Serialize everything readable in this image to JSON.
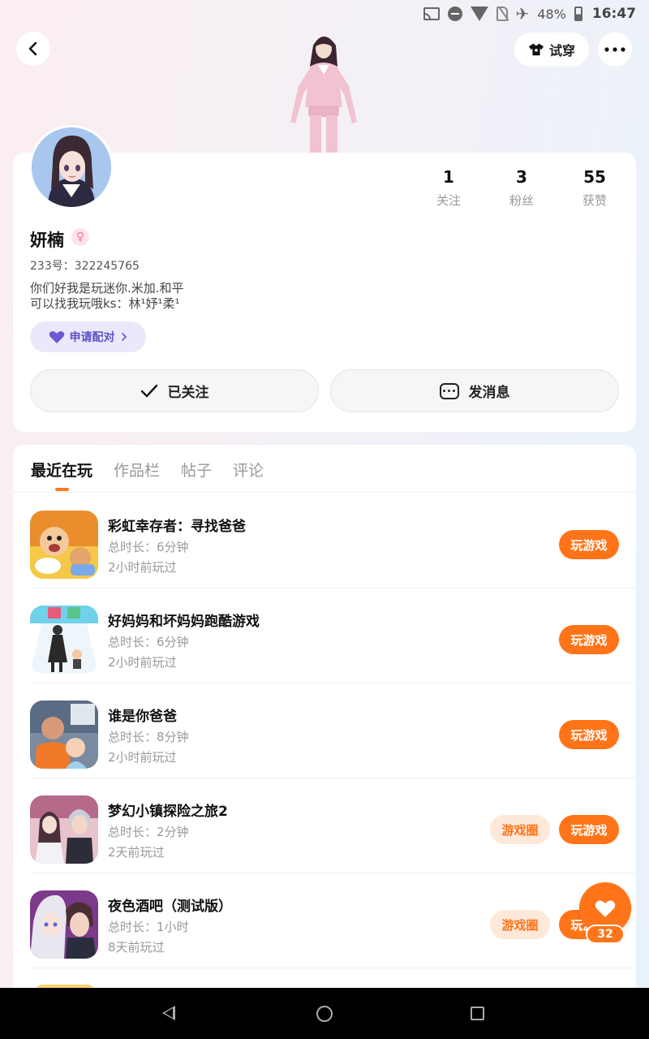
{
  "status_bar": {
    "battery": "48%",
    "time": "16:47"
  },
  "header": {
    "try_on_label": "试穿"
  },
  "profile": {
    "name": "妍楠",
    "gender_symbol": "♀",
    "uid": "233号：322245765",
    "bio": "你们好我是玩迷你.米加.和平\n可以找我玩哦ks：林¹妤¹柔¹",
    "pair_label": "申请配对",
    "stats": [
      {
        "num": "1",
        "label": "关注"
      },
      {
        "num": "3",
        "label": "粉丝"
      },
      {
        "num": "55",
        "label": "获赞"
      }
    ],
    "follow_label": "已关注",
    "message_label": "发消息"
  },
  "tabs": [
    "最近在玩",
    "作品栏",
    "帖子",
    "评论"
  ],
  "games": [
    {
      "title": "彩虹幸存者：寻找爸爸",
      "duration": "总时长：6分钟",
      "last": "2小时前玩过",
      "play": "玩游戏",
      "circle": ""
    },
    {
      "title": "好妈妈和坏妈妈跑酷游戏",
      "duration": "总时长：6分钟",
      "last": "2小时前玩过",
      "play": "玩游戏",
      "circle": ""
    },
    {
      "title": "谁是你爸爸",
      "duration": "总时长：8分钟",
      "last": "2小时前玩过",
      "play": "玩游戏",
      "circle": ""
    },
    {
      "title": "梦幻小镇探险之旅2",
      "duration": "总时长：2分钟",
      "last": "2天前玩过",
      "play": "玩游戏",
      "circle": "游戏圈"
    },
    {
      "title": "夜色酒吧（测试版）",
      "duration": "总时长：1小时",
      "last": "8天前玩过",
      "play": "玩游戏",
      "circle": "游戏圈"
    }
  ],
  "like": {
    "count": "32"
  },
  "colors": {
    "accent": "#ff7418",
    "pair": "#5b52c6"
  },
  "icons": [
    "back-arrow-icon",
    "shirt-icon",
    "more-dots-icon",
    "heart-icon",
    "check-icon",
    "chat-icon",
    "chevron-right-icon"
  ]
}
